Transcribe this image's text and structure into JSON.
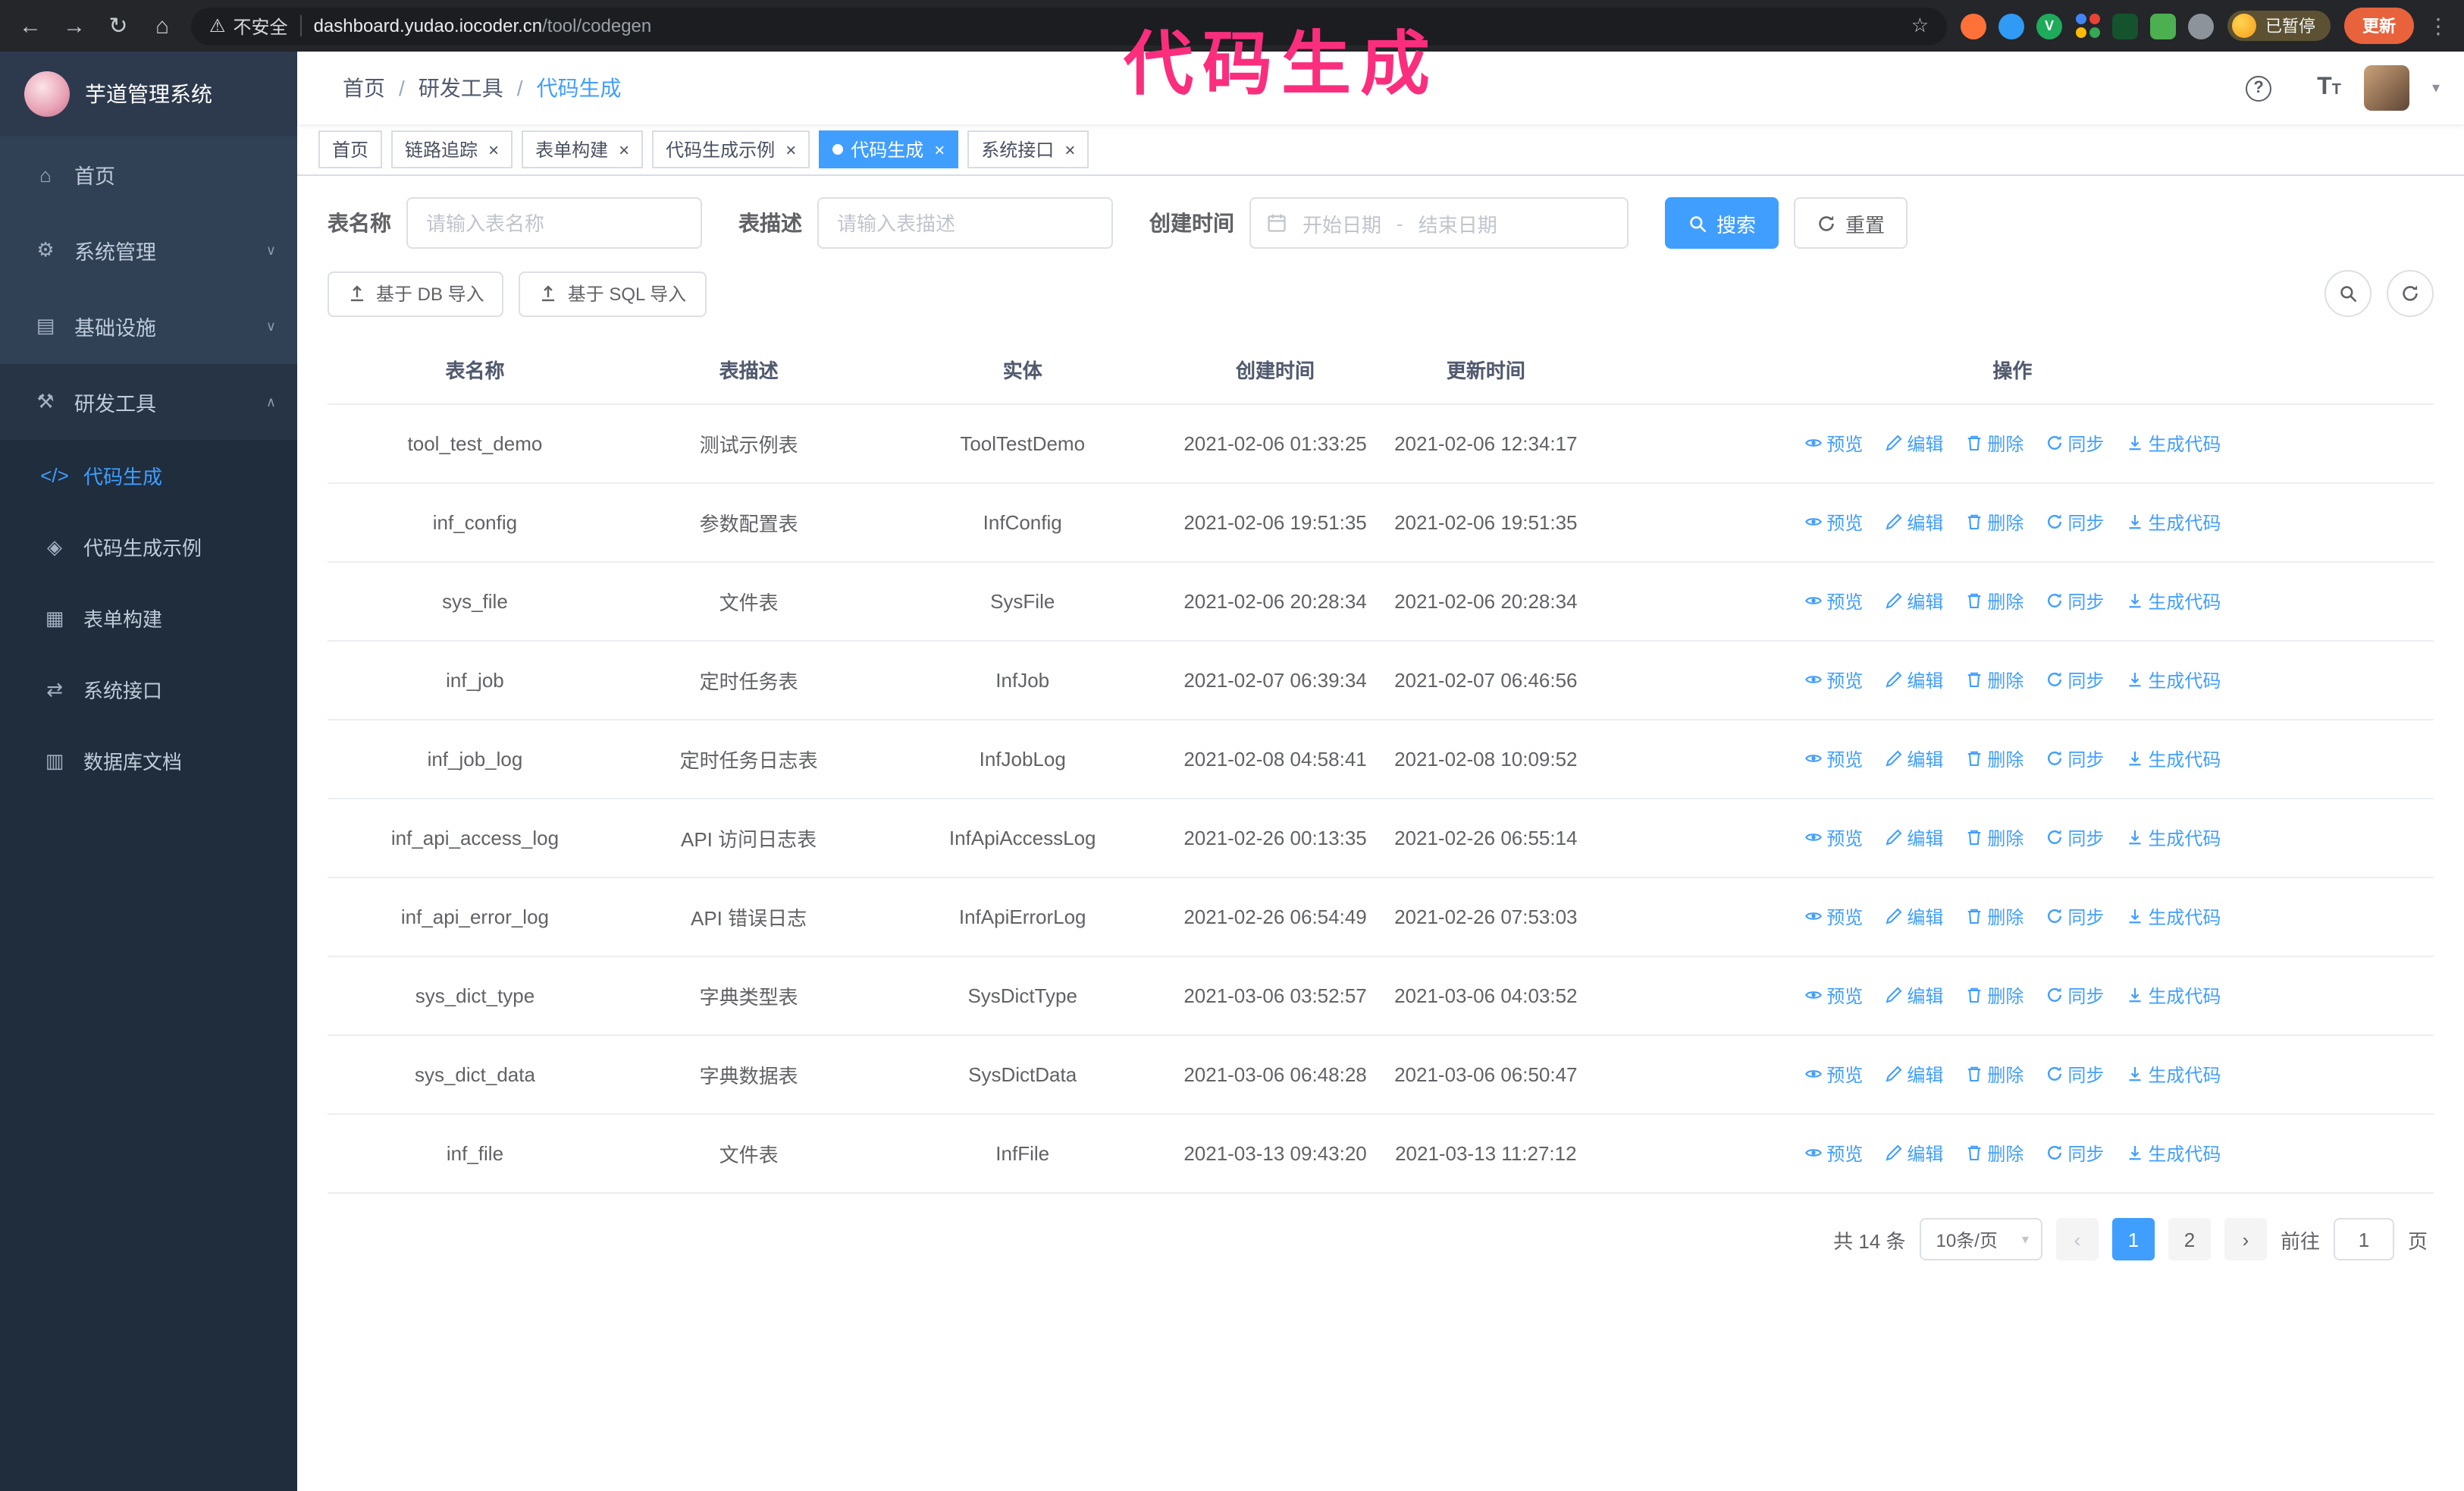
{
  "colors": {
    "accent": "#409eff",
    "annotation": "#fb2e7d",
    "update_button": "#e8623c",
    "sidebar_bg": "#304156",
    "sidebar_submenu_bg": "#1f2d3d"
  },
  "annotation": {
    "text": "代码生成"
  },
  "browser": {
    "security_label": "不安全",
    "url_host": "dashboard.yudao.iocoder.cn",
    "url_path": "/tool/codegen",
    "paused_badge": "已暂停",
    "update_button": "更新",
    "extensions": [
      {
        "shape": "circle",
        "color": "#ff7139"
      },
      {
        "shape": "circle",
        "color": "#2f9bf4"
      },
      {
        "shape": "circle",
        "color": "#1fab5c",
        "glyph": "V"
      },
      {
        "shape": "grid",
        "colors": [
          "#4285f4",
          "#ea4335",
          "#fbbc05",
          "#34a853"
        ]
      },
      {
        "shape": "square",
        "color": "#14532d"
      },
      {
        "shape": "square",
        "color": "#4caf50"
      },
      {
        "shape": "circle",
        "color": "#8d939b"
      }
    ]
  },
  "sidebar": {
    "logo_title": "芋道管理系统",
    "items": [
      {
        "key": "home",
        "icon": "home",
        "label": "首页"
      },
      {
        "key": "system",
        "icon": "gear",
        "label": "系统管理",
        "chevron": "down"
      },
      {
        "key": "infra",
        "icon": "infra",
        "label": "基础设施",
        "chevron": "down"
      },
      {
        "key": "devtools",
        "icon": "tools",
        "label": "研发工具",
        "chevron": "up",
        "children": [
          {
            "key": "codegen",
            "icon": "code",
            "label": "代码生成",
            "active": true
          },
          {
            "key": "codegen-example",
            "icon": "example",
            "label": "代码生成示例"
          },
          {
            "key": "form-builder",
            "icon": "form",
            "label": "表单构建"
          },
          {
            "key": "system-api",
            "icon": "api",
            "label": "系统接口"
          },
          {
            "key": "db-doc",
            "icon": "dbdoc",
            "label": "数据库文档"
          }
        ]
      }
    ]
  },
  "header": {
    "breadcrumb": [
      "首页",
      "研发工具",
      "代码生成"
    ]
  },
  "tabs": [
    {
      "key": "home",
      "label": "首页",
      "closable": false
    },
    {
      "key": "tracing",
      "label": "链路追踪",
      "closable": true
    },
    {
      "key": "form-builder",
      "label": "表单构建",
      "closable": true
    },
    {
      "key": "codegen-example",
      "label": "代码生成示例",
      "closable": true
    },
    {
      "key": "codegen",
      "label": "代码生成",
      "closable": true,
      "active": true
    },
    {
      "key": "system-api",
      "label": "系统接口",
      "closable": true
    }
  ],
  "filters": {
    "table_name_label": "表名称",
    "table_name_placeholder": "请输入表名称",
    "table_desc_label": "表描述",
    "table_desc_placeholder": "请输入表描述",
    "create_time_label": "创建时间",
    "start_placeholder": "开始日期",
    "range_separator": "-",
    "end_placeholder": "结束日期",
    "search_label": "搜索",
    "reset_label": "重置"
  },
  "toolbar": {
    "import_db_label": "基于 DB 导入",
    "import_sql_label": "基于 SQL 导入"
  },
  "table": {
    "columns": [
      "表名称",
      "表描述",
      "实体",
      "创建时间",
      "更新时间",
      "操作"
    ],
    "row_actions": [
      {
        "key": "preview",
        "label": "预览",
        "icon": "eye"
      },
      {
        "key": "edit",
        "label": "编辑",
        "icon": "edit"
      },
      {
        "key": "delete",
        "label": "删除",
        "icon": "trash"
      },
      {
        "key": "sync",
        "label": "同步",
        "icon": "sync"
      },
      {
        "key": "generate",
        "label": "生成代码",
        "icon": "download"
      }
    ],
    "rows": [
      {
        "name": "tool_test_demo",
        "desc": "测试示例表",
        "entity": "ToolTestDemo",
        "created": "2021-02-06 01:33:25",
        "updated": "2021-02-06 12:34:17"
      },
      {
        "name": "inf_config",
        "desc": "参数配置表",
        "entity": "InfConfig",
        "created": "2021-02-06 19:51:35",
        "updated": "2021-02-06 19:51:35"
      },
      {
        "name": "sys_file",
        "desc": "文件表",
        "entity": "SysFile",
        "created": "2021-02-06 20:28:34",
        "updated": "2021-02-06 20:28:34"
      },
      {
        "name": "inf_job",
        "desc": "定时任务表",
        "entity": "InfJob",
        "created": "2021-02-07 06:39:34",
        "updated": "2021-02-07 06:46:56"
      },
      {
        "name": "inf_job_log",
        "desc": "定时任务日志表",
        "entity": "InfJobLog",
        "created": "2021-02-08 04:58:41",
        "updated": "2021-02-08 10:09:52"
      },
      {
        "name": "inf_api_access_log",
        "desc": "API 访问日志表",
        "entity": "InfApiAccessLog",
        "created": "2021-02-26 00:13:35",
        "updated": "2021-02-26 06:55:14"
      },
      {
        "name": "inf_api_error_log",
        "desc": "API 错误日志",
        "entity": "InfApiErrorLog",
        "created": "2021-02-26 06:54:49",
        "updated": "2021-02-26 07:53:03"
      },
      {
        "name": "sys_dict_type",
        "desc": "字典类型表",
        "entity": "SysDictType",
        "created": "2021-03-06 03:52:57",
        "updated": "2021-03-06 04:03:52"
      },
      {
        "name": "sys_dict_data",
        "desc": "字典数据表",
        "entity": "SysDictData",
        "created": "2021-03-06 06:48:28",
        "updated": "2021-03-06 06:50:47"
      },
      {
        "name": "inf_file",
        "desc": "文件表",
        "entity": "InfFile",
        "created": "2021-03-13 09:43:20",
        "updated": "2021-03-13 11:27:12"
      }
    ]
  },
  "pagination": {
    "total_text": "共 14 条",
    "page_size_label": "10条/页",
    "pages": [
      "1",
      "2"
    ],
    "active_page": "1",
    "goto_prefix": "前往",
    "goto_value": "1",
    "goto_suffix": "页"
  }
}
